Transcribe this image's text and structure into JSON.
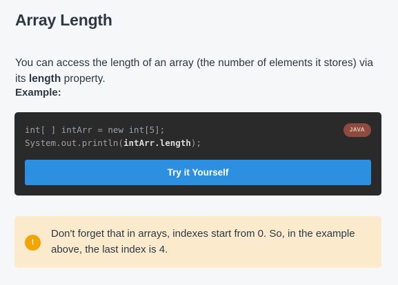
{
  "heading": "Array Length",
  "intro": {
    "before": "You can access the length of an array (the number of elements it stores) via its ",
    "keyword": "length",
    "after": " property."
  },
  "example_label": "Example:",
  "code": {
    "line1": "int[ ] intArr = new int[5];",
    "line2_before": "System.out.println(",
    "line2_highlight": "intArr.length",
    "line2_after": ");",
    "language_badge": "JAVA",
    "try_button": "Try it Yourself"
  },
  "note": {
    "icon": "exclamation-icon",
    "text": "Don't forget that in arrays, indexes start from 0. So, in the example above, the last index is 4."
  },
  "colors": {
    "page_background": "#f6f7f9",
    "code_background": "#2a2a2a",
    "button": "#2d8fe0",
    "badge": "#8f4a3e",
    "note_background": "#fbebcc",
    "note_icon": "#f0a500"
  }
}
